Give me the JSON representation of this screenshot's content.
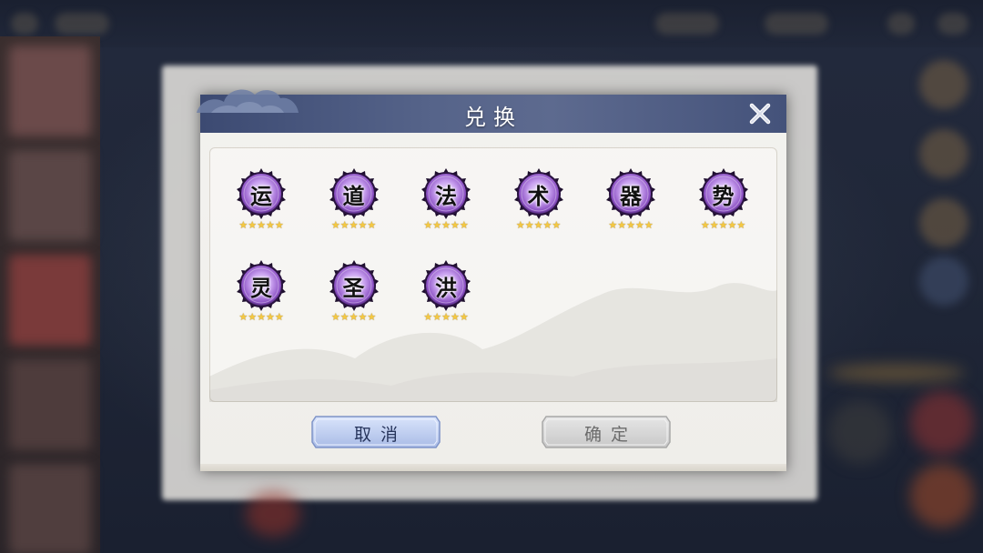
{
  "dialog": {
    "title": "兑换",
    "close_icon": "close-icon",
    "cancel_label": "取消",
    "confirm_label": "确定"
  },
  "items": [
    {
      "glyph": "运",
      "stars": 5
    },
    {
      "glyph": "道",
      "stars": 5
    },
    {
      "glyph": "法",
      "stars": 5
    },
    {
      "glyph": "术",
      "stars": 5
    },
    {
      "glyph": "器",
      "stars": 5
    },
    {
      "glyph": "势",
      "stars": 5
    },
    {
      "glyph": "灵",
      "stars": 5
    },
    {
      "glyph": "圣",
      "stars": 5
    },
    {
      "glyph": "洪",
      "stars": 5
    }
  ],
  "colors": {
    "header": "#4b5980",
    "medallion_purple": "#8a4fc2",
    "star_gold": "#f4c842",
    "cancel_button": "#b9c9ee",
    "confirm_button_disabled": "#d4d4d4"
  }
}
